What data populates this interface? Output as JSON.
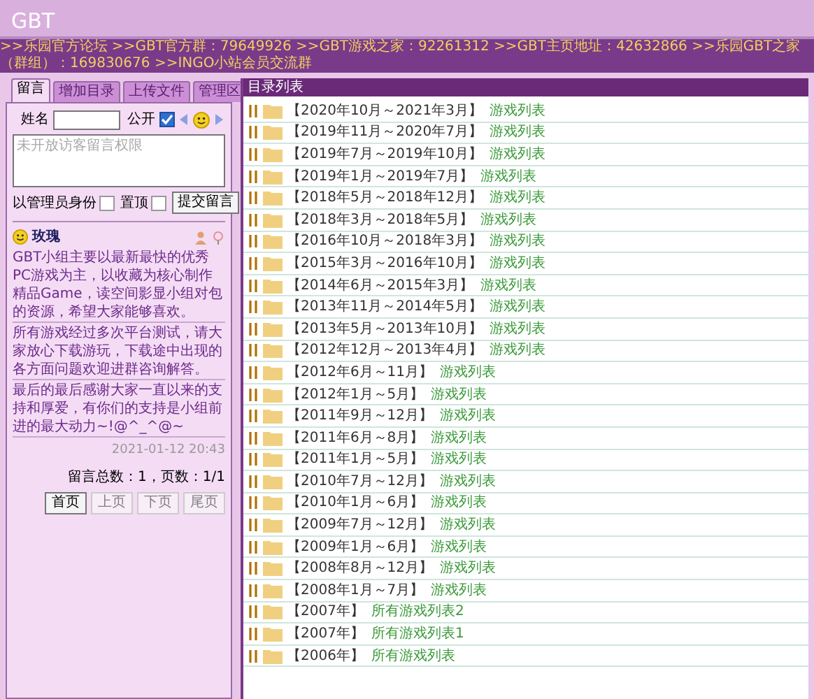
{
  "header": {
    "title": "GBT"
  },
  "notice_bar": ">>乐园官方论坛 >>GBT官方群：79649926 >>GBT游戏之家：92261312 >>GBT主页地址：42632866 >>乐园GBT之家（群组）：169830676 >>INGO小站会员交流群",
  "tabs": [
    {
      "label": "留言",
      "selected": true
    },
    {
      "label": "增加目录",
      "selected": false
    },
    {
      "label": "上传文件",
      "selected": false
    },
    {
      "label": "管理区",
      "selected": false
    }
  ],
  "form": {
    "name_label": "姓名",
    "public_label": "公开",
    "public_checked": true,
    "message_placeholder": "未开放访客留言权限",
    "admin_label": "以管理员身份",
    "admin_checked": false,
    "pin_label": "置顶",
    "pin_checked": false,
    "submit": "提交留言"
  },
  "message": {
    "author": "玫瑰",
    "paragraphs": [
      "GBT小组主要以最新最快的优秀PC游戏为主，以收藏为核心制作精品Game，读空间影显小组对包的资源，希望大家能够喜欢。",
      "所有游戏经过多次平台测试，请大家放心下载游玩，下载途中出现的各方面问题欢迎进群咨询解答。",
      "最后的最后感谢大家一直以来的支持和厚爱，有你们的支持是小组前进的最大动力~!@^_^@~"
    ],
    "time": "2021-01-12 20:43"
  },
  "pager": {
    "summary": "留言总数：1，页数：1/1",
    "buttons": [
      {
        "label": "首页",
        "disabled": false
      },
      {
        "label": "上页",
        "disabled": true
      },
      {
        "label": "下页",
        "disabled": true
      },
      {
        "label": "尾页",
        "disabled": true
      }
    ]
  },
  "directory": {
    "title": "目录列表",
    "rows": [
      {
        "name": "【2020年10月～2021年3月】",
        "link": "游戏列表"
      },
      {
        "name": "【2019年11月～2020年7月】",
        "link": "游戏列表"
      },
      {
        "name": "【2019年7月～2019年10月】",
        "link": "游戏列表"
      },
      {
        "name": "【2019年1月～2019年7月】",
        "link": "游戏列表"
      },
      {
        "name": "【2018年5月～2018年12月】",
        "link": "游戏列表"
      },
      {
        "name": "【2018年3月～2018年5月】",
        "link": "游戏列表"
      },
      {
        "name": "【2016年10月～2018年3月】",
        "link": "游戏列表"
      },
      {
        "name": "【2015年3月～2016年10月】",
        "link": "游戏列表"
      },
      {
        "name": "【2014年6月～2015年3月】",
        "link": "游戏列表"
      },
      {
        "name": "【2013年11月～2014年5月】",
        "link": "游戏列表"
      },
      {
        "name": "【2013年5月～2013年10月】",
        "link": "游戏列表"
      },
      {
        "name": "【2012年12月～2013年4月】",
        "link": "游戏列表"
      },
      {
        "name": "【2012年6月～11月】",
        "link": "游戏列表"
      },
      {
        "name": "【2012年1月～5月】",
        "link": "游戏列表"
      },
      {
        "name": "【2011年9月～12月】",
        "link": "游戏列表"
      },
      {
        "name": "【2011年6月～8月】",
        "link": "游戏列表"
      },
      {
        "name": "【2011年1月～5月】",
        "link": "游戏列表"
      },
      {
        "name": "【2010年7月～12月】",
        "link": "游戏列表"
      },
      {
        "name": "【2010年1月～6月】",
        "link": "游戏列表"
      },
      {
        "name": "【2009年7月～12月】",
        "link": "游戏列表"
      },
      {
        "name": "【2009年1月～6月】",
        "link": "游戏列表"
      },
      {
        "name": "【2008年8月～12月】",
        "link": "游戏列表"
      },
      {
        "name": "【2008年1月～7月】",
        "link": "游戏列表"
      },
      {
        "name": "【2007年】",
        "link": "所有游戏列表2"
      },
      {
        "name": "【2007年】",
        "link": "所有游戏列表1"
      },
      {
        "name": "【2006年】",
        "link": "所有游戏列表"
      }
    ]
  }
}
